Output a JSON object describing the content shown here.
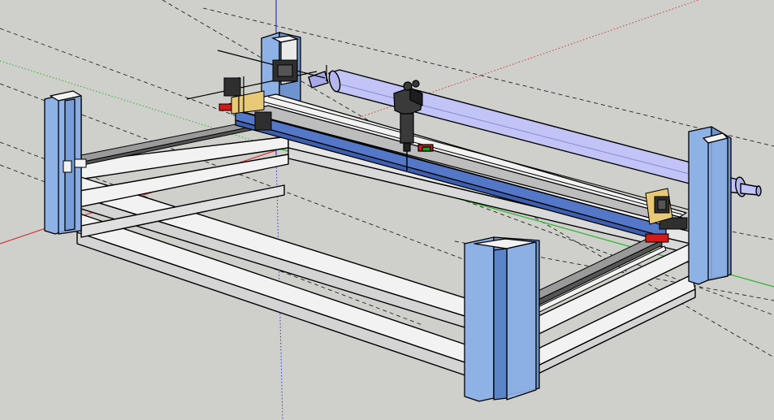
{
  "viewport": {
    "background": "#cfcfcc",
    "colors": {
      "edge": "#000000",
      "frame_top": "#f2f2f2",
      "frame_side": "#d9d9d9",
      "post_blue": "#8fb2e6",
      "post_blue_dark": "#6e93cf",
      "gantry_blue": "#5577c8",
      "tube": "#c2c3f7",
      "tube_dark": "#a7a8e6",
      "motor": "#2f2f2f",
      "bracket": "#e7c977",
      "accent_red": "#d11a1a",
      "accent_green": "#1b9a1b",
      "axis_red": "#d33b3b",
      "axis_green": "#2ab52a",
      "axis_blue": "#3333cc",
      "guide_dash": "#222222"
    },
    "components": [
      "frame",
      "corner-post",
      "gantry-beam",
      "laser-tube",
      "laser-head",
      "stepper-motor",
      "linear-rail"
    ]
  }
}
